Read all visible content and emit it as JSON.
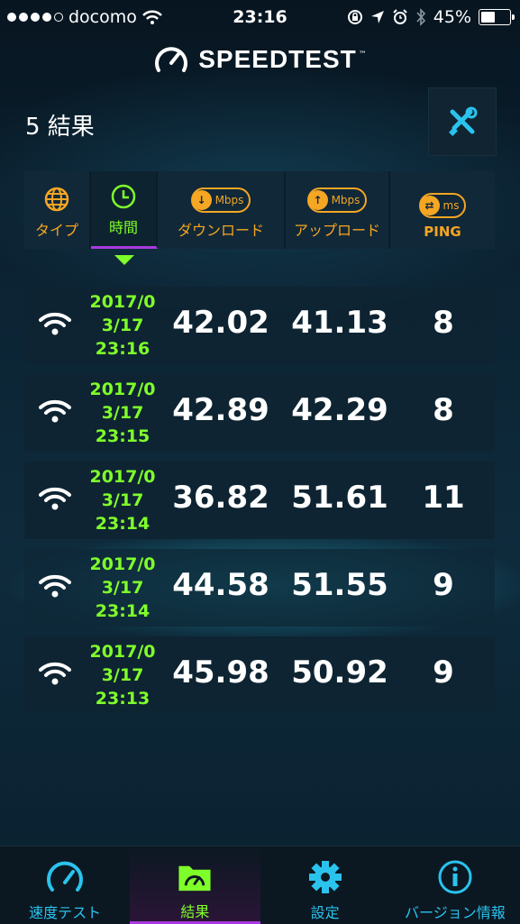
{
  "status_bar": {
    "carrier": "docomo",
    "time": "23:16",
    "battery": "45%",
    "battery_level": 0.45,
    "signal_bars": 4
  },
  "header": {
    "logo_text": "SPEEDTEST",
    "trademark": "™"
  },
  "results_count": "5 結果",
  "filters": [
    {
      "label": "タイプ",
      "icon": "globe-icon"
    },
    {
      "label": "時間",
      "icon": "clock-icon",
      "active": true
    },
    {
      "label": "ダウンロード",
      "icon": "download-icon",
      "unit": "Mbps"
    },
    {
      "label": "アップロード",
      "icon": "upload-icon",
      "unit": "Mbps"
    },
    {
      "label": "PING",
      "icon": "ping-icon",
      "unit": "ms"
    }
  ],
  "results": [
    {
      "date_line1": "2017/0",
      "date_line2": "3/17",
      "time": "23:16",
      "download": "42.02",
      "upload": "41.13",
      "ping": "8"
    },
    {
      "date_line1": "2017/0",
      "date_line2": "3/17",
      "time": "23:15",
      "download": "42.89",
      "upload": "42.29",
      "ping": "8"
    },
    {
      "date_line1": "2017/0",
      "date_line2": "3/17",
      "time": "23:14",
      "download": "36.82",
      "upload": "51.61",
      "ping": "11"
    },
    {
      "date_line1": "2017/0",
      "date_line2": "3/17",
      "time": "23:14",
      "download": "44.58",
      "upload": "51.55",
      "ping": "9"
    },
    {
      "date_line1": "2017/0",
      "date_line2": "3/17",
      "time": "23:13",
      "download": "45.98",
      "upload": "50.92",
      "ping": "9"
    }
  ],
  "tabs": [
    {
      "label": "速度テスト",
      "icon": "speedometer-icon"
    },
    {
      "label": "結果",
      "icon": "results-folder-icon",
      "active": true
    },
    {
      "label": "設定",
      "icon": "gear-icon"
    },
    {
      "label": "バージョン情報",
      "icon": "info-icon"
    }
  ],
  "colors": {
    "accent_green": "#7fff2a",
    "accent_orange": "#f5a623",
    "accent_blue": "#2ac3ee",
    "accent_purple": "#a83be0",
    "background": "#0b1d2b"
  }
}
